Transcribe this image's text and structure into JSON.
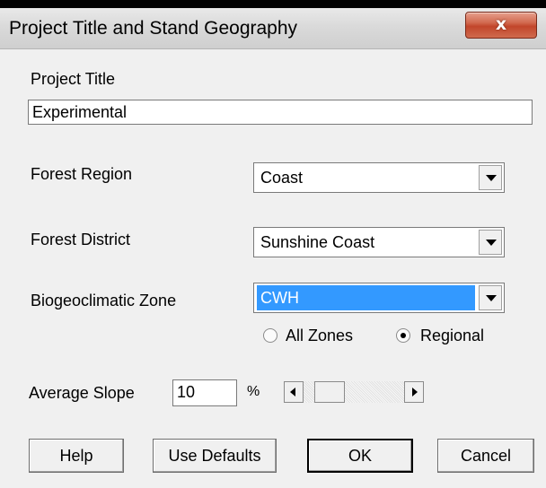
{
  "window": {
    "title": "Project Title and Stand Geography",
    "close_glyph": "x"
  },
  "project_title": {
    "label": "Project Title",
    "value": "Experimental"
  },
  "forest_region": {
    "label": "Forest Region",
    "value": "Coast"
  },
  "forest_district": {
    "label": "Forest District",
    "value": "Sunshine Coast"
  },
  "bgc_zone": {
    "label": "Biogeoclimatic Zone",
    "value": "CWH",
    "options": [
      {
        "label": "All Zones",
        "checked": false
      },
      {
        "label": "Regional",
        "checked": true
      }
    ]
  },
  "slope": {
    "label": "Average Slope",
    "value": "10",
    "unit": "%",
    "scroll_position": 0.1
  },
  "buttons": {
    "help": "Help",
    "use_defaults": "Use Defaults",
    "ok": "OK",
    "cancel": "Cancel"
  },
  "colors": {
    "selection": "#3399ff",
    "dialog_bg": "#f0f0f0",
    "close_button": "#c2462b"
  },
  "icons": {
    "close": "close-icon",
    "dropdown": "chevron-down-icon",
    "scroll_left": "arrow-left-icon",
    "scroll_right": "arrow-right-icon"
  }
}
